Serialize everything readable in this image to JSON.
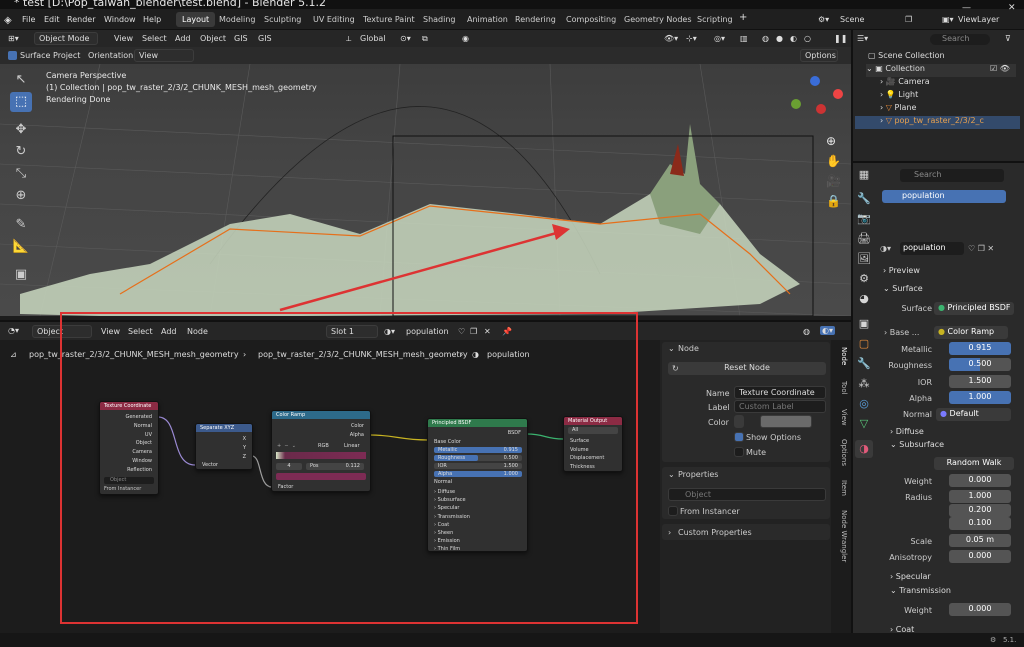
{
  "titlebar": {
    "title": "* test [D:\\Pop_taiwan_blender\\test.blend] - Blender 5.1.2"
  },
  "menu": {
    "items": [
      "File",
      "Edit",
      "Render",
      "Window",
      "Help"
    ]
  },
  "workspaces": [
    "Layout",
    "Modeling",
    "Sculpting",
    "UV Editing",
    "Texture Paint",
    "Shading",
    "Animation",
    "Rendering",
    "Compositing",
    "Geometry Nodes",
    "Scripting"
  ],
  "workspace_active": "Layout",
  "top_right": {
    "scene": "Scene",
    "viewlayer": "ViewLayer"
  },
  "viewport_header": {
    "mode": "Object Mode",
    "menus": [
      "View",
      "Select",
      "Add",
      "Object",
      "GIS",
      "GIS"
    ],
    "orientation": "Global",
    "options": "Options"
  },
  "tool_options": {
    "surface_project": "Surface Project",
    "orientation_label": "Orientation:",
    "orientation_value": "View"
  },
  "viewport_overlay": {
    "line1": "Camera Perspective",
    "line2": "(1) Collection | pop_tw_raster_2/3/2_CHUNK_MESH_mesh_geometry",
    "line3": "Rendering Done"
  },
  "node_header": {
    "editor": "Object",
    "menus": [
      "View",
      "Select",
      "Add",
      "Node"
    ],
    "slot": "Slot 1",
    "material": "population"
  },
  "breadcrumb": {
    "item1": "pop_tw_raster_2/3/2_CHUNK_MESH_mesh_geometry",
    "item2": "pop_tw_raster_2/3/2_CHUNK_MESH_mesh_geometry",
    "item3": "population"
  },
  "nodes": {
    "texcoord": {
      "title": "Texture Coordinate",
      "outputs": [
        "Generated",
        "Normal",
        "UV",
        "Object",
        "Camera",
        "Window",
        "Reflection"
      ],
      "object_placeholder": "Object",
      "from_instancer": "From Instancer"
    },
    "sepxyz": {
      "title": "Separate XYZ",
      "outputs": [
        "X",
        "Y",
        "Z"
      ],
      "input": "Vector"
    },
    "ramp": {
      "title": "Color Ramp",
      "outputs": [
        "Color",
        "Alpha"
      ],
      "mode": "RGB",
      "interp": "Linear",
      "index": "4",
      "pos_label": "Pos",
      "pos_value": "0.112",
      "input": "Factor"
    },
    "bsdf": {
      "title": "Principled BSDF",
      "output": "BSDF",
      "base_color": "Base Color",
      "metallic": "Metallic",
      "metallic_v": "0.915",
      "roughness": "Roughness",
      "roughness_v": "0.500",
      "ior": "IOR",
      "ior_v": "1.500",
      "alpha": "Alpha",
      "alpha_v": "1.000",
      "normal": "Normal",
      "panels": [
        "Diffuse",
        "Subsurface",
        "Specular",
        "Transmission",
        "Coat",
        "Sheen",
        "Emission",
        "Thin Film"
      ]
    },
    "output": {
      "title": "Material Output",
      "target": "All",
      "inputs": [
        "Surface",
        "Volume",
        "Displacement",
        "Thickness"
      ]
    }
  },
  "npanel": {
    "node_title": "Node",
    "reset": "Reset Node",
    "name_label": "Name",
    "name_value": "Texture Coordinate",
    "label_label": "Label",
    "label_placeholder": "Custom Label",
    "color_label": "Color",
    "show_options": "Show Options",
    "mute": "Mute",
    "properties": "Properties",
    "object_placeholder": "Object",
    "from_instancer": "From Instancer",
    "custom_props": "Custom Properties",
    "tabs": [
      "Node",
      "Tool",
      "View",
      "Options",
      "Item",
      "Node Wrangler"
    ]
  },
  "outliner": {
    "search": "Search",
    "root": "Scene Collection",
    "collection": "Collection",
    "items": [
      "Camera",
      "Light",
      "Plane",
      "pop_tw_raster_2/3/2_c"
    ]
  },
  "properties": {
    "search": "Search",
    "material_slot": "population",
    "material_name": "population",
    "preview": "Preview",
    "surface_section": "Surface",
    "surface_label": "Surface",
    "surface_value": "Principled BSDF",
    "base_label": "Base ...",
    "base_value": "Color Ramp",
    "metallic_label": "Metallic",
    "metallic_value": "0.915",
    "roughness_label": "Roughness",
    "roughness_value": "0.500",
    "ior_label": "IOR",
    "ior_value": "1.500",
    "alpha_label": "Alpha",
    "alpha_value": "1.000",
    "normal_label": "Normal",
    "normal_value": "Default",
    "diffuse": "Diffuse",
    "subsurface": "Subsurface",
    "sss_method": "Random Walk",
    "weight_label": "Weight",
    "weight_value": "0.000",
    "radius_label": "Radius",
    "radius_r": "1.000",
    "radius_g": "0.200",
    "radius_b": "0.100",
    "scale_label": "Scale",
    "scale_value": "0.05 m",
    "aniso_label": "Anisotropy",
    "aniso_value": "0.000",
    "specular": "Specular",
    "transmission": "Transmission",
    "tweight_label": "Weight",
    "tweight_value": "0.000",
    "coat": "Coat"
  },
  "status": {
    "version": "5.1."
  },
  "colors": {
    "accent": "#4772b3",
    "redbox": "#dd3333",
    "terrain": "#c9d8c0"
  }
}
